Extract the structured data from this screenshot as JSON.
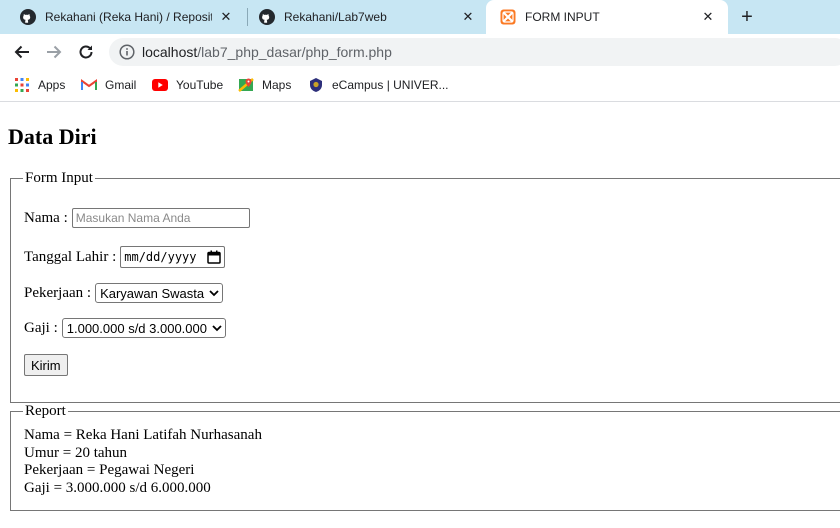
{
  "browser": {
    "tabs": [
      {
        "title": "Rekahani (Reka Hani) / Repository",
        "close": "✕",
        "favicon": "github-icon",
        "active": false
      },
      {
        "title": "Rekahani/Lab7web",
        "close": "✕",
        "favicon": "github-icon",
        "active": false
      },
      {
        "title": "FORM INPUT",
        "close": "✕",
        "favicon": "xampp-icon",
        "active": true
      }
    ],
    "new_tab": "+",
    "url_host": "localhost",
    "url_path": "/lab7_php_dasar/php_form.php",
    "bookmarks": [
      {
        "label": "Apps",
        "icon": "apps-grid-icon"
      },
      {
        "label": "Gmail",
        "icon": "gmail-icon"
      },
      {
        "label": "YouTube",
        "icon": "youtube-icon"
      },
      {
        "label": "Maps",
        "icon": "maps-icon"
      },
      {
        "label": "eCampus | UNIVER...",
        "icon": "ecampus-icon"
      }
    ]
  },
  "page": {
    "title": "Data Diri",
    "form": {
      "legend": "Form Input",
      "nama_label": "Nama :",
      "nama_placeholder": "Masukan Nama Anda",
      "tanggal_label": "Tanggal Lahir :",
      "tanggal_value": "mm/dd/yyyy",
      "pekerjaan_label": "Pekerjaan :",
      "pekerjaan_value": "Karyawan Swasta",
      "gaji_label": "Gaji :",
      "gaji_value": "1.000.000 s/d 3.000.000",
      "submit_label": "Kirim"
    },
    "report": {
      "legend": "Report",
      "lines": [
        "Nama = Reka Hani Latifah Nurhasanah",
        "Umur = 20 tahun",
        "Pekerjaan = Pegawai Negeri",
        "Gaji = 3.000.000 s/d 6.000.000"
      ]
    }
  }
}
